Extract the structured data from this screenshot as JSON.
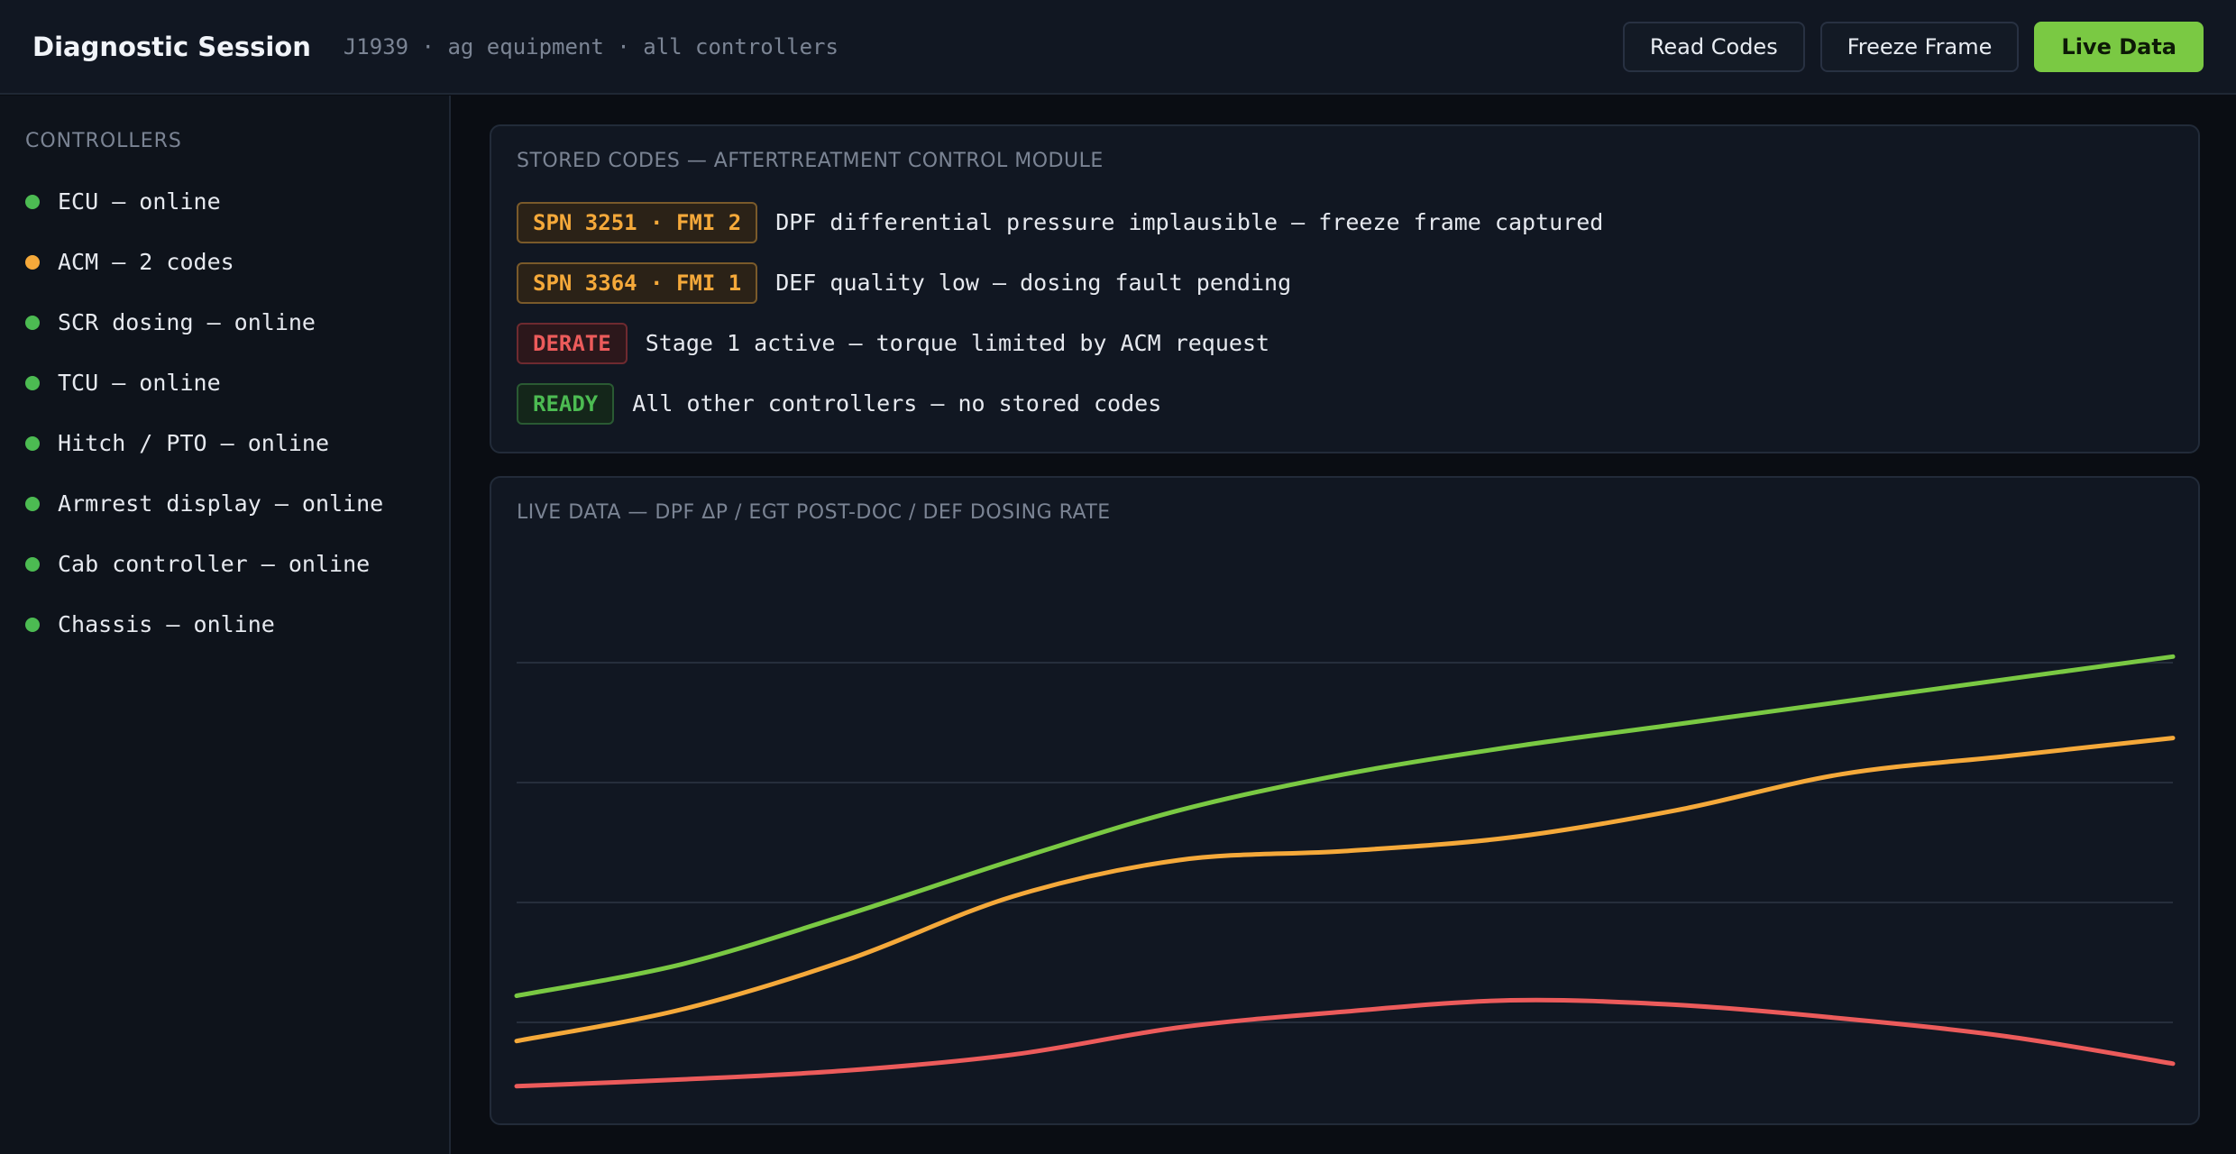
{
  "header": {
    "title": "Diagnostic Session",
    "subtitle": "J1939 · ag equipment · all controllers",
    "buttons": {
      "read_codes": "Read Codes",
      "freeze_frame": "Freeze Frame",
      "live_data": "Live Data"
    }
  },
  "sidebar": {
    "heading": "CONTROLLERS",
    "items": [
      {
        "label": "ECU — online",
        "status": "online"
      },
      {
        "label": "ACM — 2 codes",
        "status": "warning"
      },
      {
        "label": "SCR dosing — online",
        "status": "online"
      },
      {
        "label": "TCU — online",
        "status": "online"
      },
      {
        "label": "Hitch / PTO — online",
        "status": "online"
      },
      {
        "label": "Armrest display — online",
        "status": "online"
      },
      {
        "label": "Cab controller — online",
        "status": "online"
      },
      {
        "label": "Chassis — online",
        "status": "online"
      }
    ]
  },
  "stored_codes": {
    "title": "STORED CODES — AFTERTREATMENT CONTROL MODULE",
    "rows": [
      {
        "badge": "SPN 3251 · FMI 2",
        "tone": "amber",
        "text": "DPF differential pressure implausible — freeze frame captured"
      },
      {
        "badge": "SPN 3364 · FMI 1",
        "tone": "amber",
        "text": "DEF quality low — dosing fault pending"
      },
      {
        "badge": "DERATE",
        "tone": "red",
        "text": "Stage 1 active — torque limited by ACM request"
      },
      {
        "badge": "READY",
        "tone": "green",
        "text": "All other controllers — no stored codes"
      }
    ]
  },
  "live_data": {
    "title": "LIVE DATA — DPF ΔP / EGT POST-DOC / DEF DOSING RATE"
  },
  "colors": {
    "online": "#4cbb52",
    "warning": "#f5a93a",
    "accent": "#7ac943",
    "critical": "#ec5b5b"
  },
  "chart_data": {
    "type": "line",
    "title": "LIVE DATA — DPF ΔP / EGT POST-DOC / DEF DOSING RATE",
    "xlabel": "",
    "ylabel": "",
    "grid": true,
    "ylim": [
      0,
      100
    ],
    "x": [
      0,
      10,
      20,
      30,
      40,
      50,
      60,
      70,
      80,
      90,
      100
    ],
    "series": [
      {
        "color": "#7ac943",
        "values": [
          10,
          17,
          28,
          40,
          51,
          59,
          65,
          70,
          75,
          80,
          85
        ]
      },
      {
        "color": "#f5a93a",
        "values": [
          0,
          7,
          18,
          32,
          40,
          42,
          45,
          51,
          59,
          63,
          67
        ]
      },
      {
        "color": "#ec5b5b",
        "values": [
          -10,
          -8.5,
          -6.5,
          -3,
          3,
          6.5,
          9,
          8,
          5,
          1,
          -5
        ]
      }
    ]
  }
}
